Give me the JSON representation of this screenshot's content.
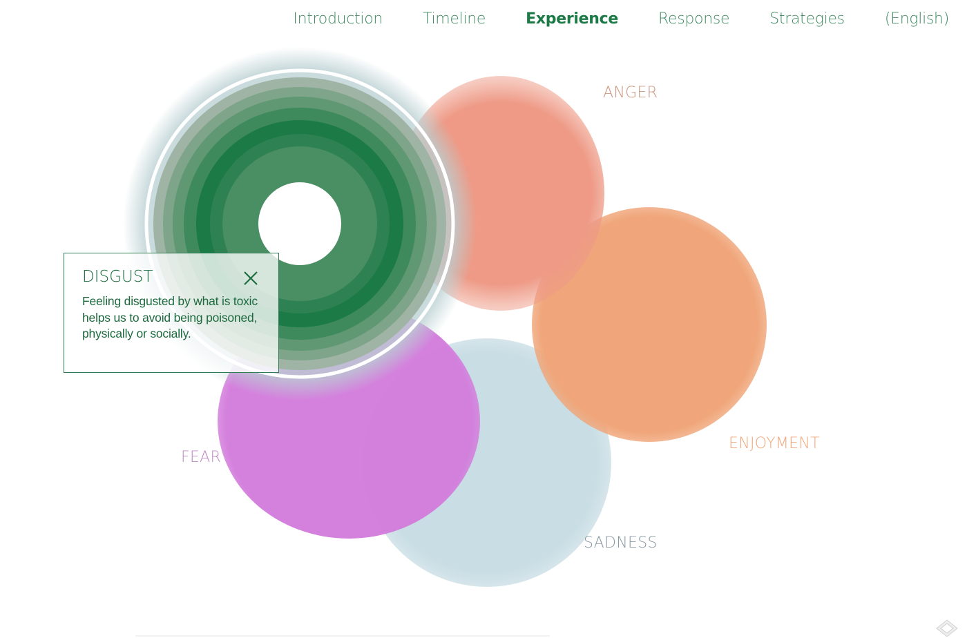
{
  "nav": {
    "items": [
      {
        "label": "Introduction"
      },
      {
        "label": "Timeline"
      },
      {
        "label": "Experience",
        "active": true
      },
      {
        "label": "Response"
      },
      {
        "label": "Strategies"
      },
      {
        "label": "(English)"
      }
    ]
  },
  "emotions": {
    "anger": {
      "label": "ANGER",
      "color": "#ee9a86"
    },
    "enjoyment": {
      "label": "ENJOYMENT",
      "color": "#f0a67a"
    },
    "fear": {
      "label": "FEAR",
      "color": "#d37ddc"
    },
    "sadness": {
      "label": "SADNESS",
      "color": "#c8dde4"
    },
    "disgust": {
      "color": "#1b7a45"
    }
  },
  "card": {
    "title": "DISGUST",
    "body": "Feeling disgusted by what is toxic helps us to avoid being poisoned, physically or socially.",
    "close_icon": "close-icon"
  },
  "colors": {
    "accent": "#1b7a45",
    "nav_text": "#3d8a5f"
  }
}
